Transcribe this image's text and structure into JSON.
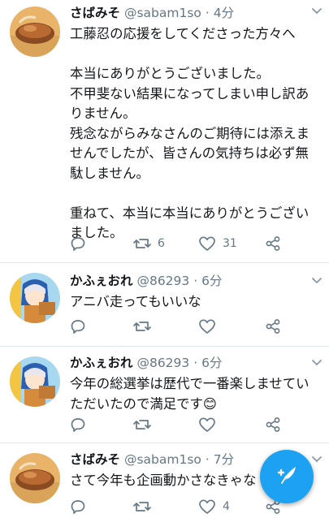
{
  "tweets": [
    {
      "name": "さばみそ",
      "handle": "@sabam1so",
      "dot": "·",
      "time": "4分",
      "text": "工藤忍の応援をしてくださった方々へ\n\n本当にありがとうございました。\n不甲斐ない結果になってしまい申し訳ありません。\n残念ながらみなさんのご期待には添えませんでしたが、皆さんの気持ちは必ず無駄しません。\n\n重ねて、本当に本当にありがとうございました。",
      "retweets": "6",
      "likes": "31"
    },
    {
      "name": "かふぇおれ",
      "handle": "@86293",
      "dot": "·",
      "time": "6分",
      "text": "アニバ走ってもいいな",
      "retweets": "",
      "likes": ""
    },
    {
      "name": "かふぇおれ",
      "handle": "@86293",
      "dot": "·",
      "time": "6分",
      "text": "今年の総選挙は歴代で一番楽しませていただいたので満足です😊",
      "retweets": "",
      "likes": ""
    },
    {
      "name": "さばみそ",
      "handle": "@sabam1so",
      "dot": "·",
      "time": "7分",
      "text": "さて今年も企画動かさなきゃな",
      "retweets": "",
      "likes": "4"
    }
  ],
  "icons": {
    "reply": "reply-icon",
    "retweet": "retweet-icon",
    "like": "like-icon",
    "share": "share-icon",
    "caret": "chevron-down-icon",
    "compose": "compose-tweet-icon"
  },
  "colors": {
    "accent": "#1da1f2",
    "secondary_text": "#657786",
    "divider": "#e1e8ed"
  }
}
